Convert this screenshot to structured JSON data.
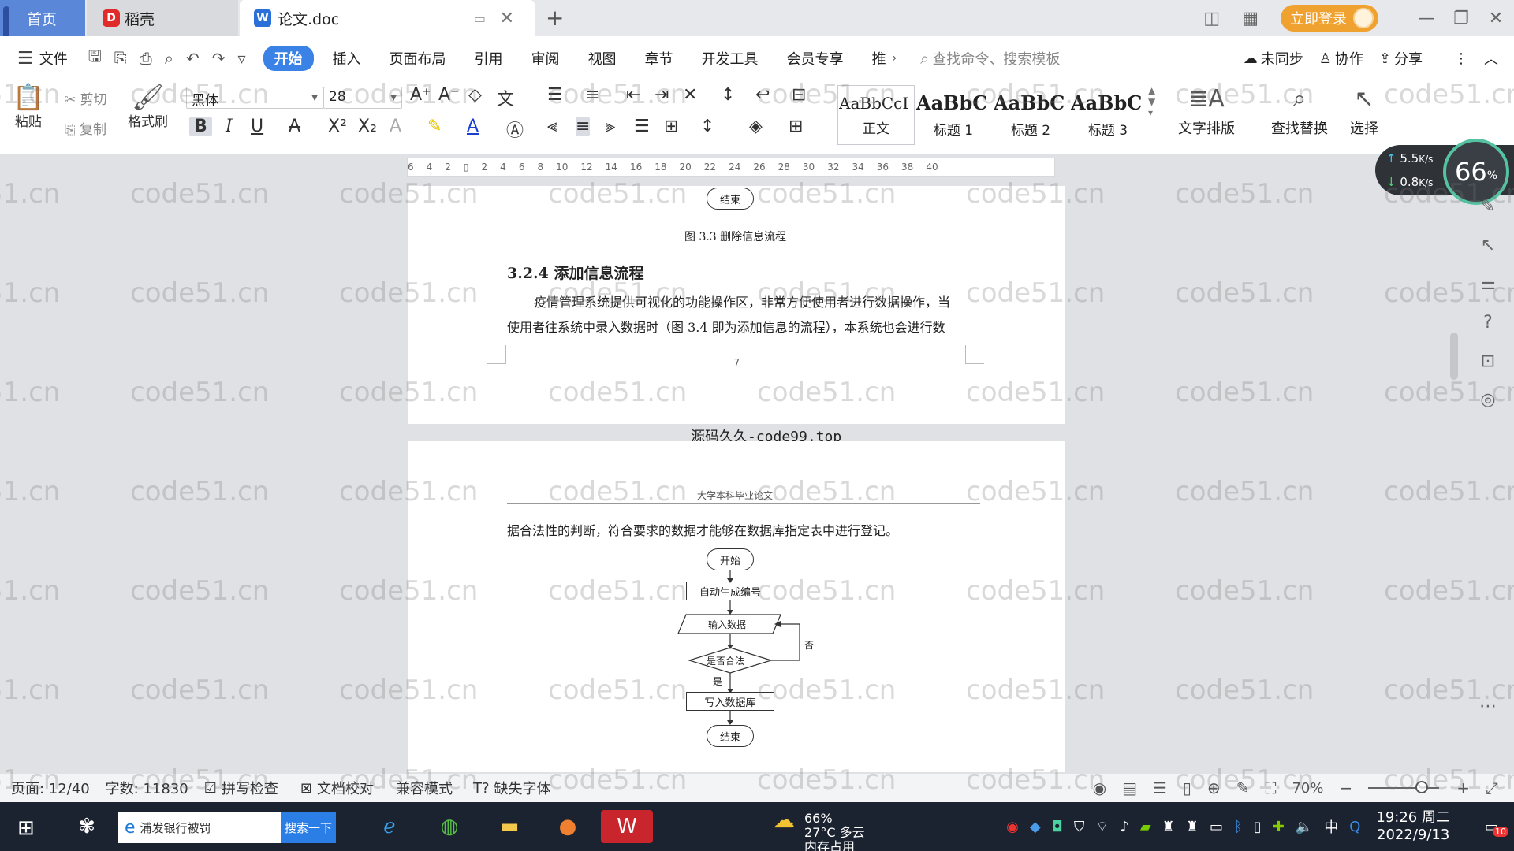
{
  "tabs": {
    "home": "首页",
    "daoke": "稻壳",
    "doc": "论文.doc"
  },
  "titlebar": {
    "login": "立即登录"
  },
  "menubar": {
    "file": "文件",
    "items": [
      "开始",
      "插入",
      "页面布局",
      "引用",
      "审阅",
      "视图",
      "章节",
      "开发工具",
      "会员专享",
      "推"
    ],
    "search_cmd": "查找命令、搜索模板",
    "unsync": "未同步",
    "collab": "协作",
    "share": "分享"
  },
  "ribbon": {
    "paste": "粘贴",
    "cut": "剪切",
    "copy": "复制",
    "format_painter": "格式刷",
    "font": "黑体",
    "size": "28",
    "styles": [
      {
        "sample": "AaBbCcI",
        "name": "正文"
      },
      {
        "sample": "AaBbC",
        "name": "标题 1"
      },
      {
        "sample": "AaBbC",
        "name": "标题 2"
      },
      {
        "sample": "AaBbC",
        "name": "标题 3"
      }
    ],
    "text_layout": "文字排版",
    "find_replace": "查找替换",
    "select": "选择"
  },
  "ruler": [
    "6",
    "4",
    "2",
    "",
    "2",
    "4",
    "6",
    "8",
    "10",
    "12",
    "14",
    "16",
    "18",
    "20",
    "22",
    "24",
    "26",
    "28",
    "30",
    "32",
    "34",
    "36",
    "38",
    "40"
  ],
  "doc": {
    "end_top": "结束",
    "fig33": "图 3.3  删除信息流程",
    "heading": "3.2.4  添加信息流程",
    "para1": "疫情管理系统提供可视化的功能操作区，非常方便使用者进行数据操作，当",
    "para2": "使用者往系统中录入数据时（图 3.4 即为添加信息的流程），本系统也会进行数",
    "page_num": "7",
    "separator": "源码久久-code99.top",
    "header": "大学本科毕业论文",
    "para3": "据合法性的判断，符合要求的数据才能够在数据库指定表中进行登记。",
    "flow": {
      "start": "开始",
      "auto": "自动生成编号",
      "input": "输入数据",
      "check": "是否合法",
      "no": "否",
      "yes": "是",
      "write": "写入数据库",
      "end": "结束"
    }
  },
  "network": {
    "up": "5.5",
    "down": "0.8",
    "unit": "K/s",
    "percent": "66",
    "pct_sign": "%"
  },
  "status": {
    "page": "页面: 12/40",
    "words": "字数: 11830",
    "spell": "拼写检查",
    "proof": "文档校对",
    "compat": "兼容模式",
    "missing_font": "缺失字体",
    "zoom": "70%"
  },
  "taskbar": {
    "search_text": "浦发银行被罚",
    "search_btn": "搜索一下",
    "weather_temp": "27°C 多云",
    "mem_pct": "66%",
    "mem_label": "内存占用",
    "ime": "中",
    "time": "19:26 周二",
    "date": "2022/9/13",
    "notif": "10"
  },
  "watermark": "code51.cn"
}
